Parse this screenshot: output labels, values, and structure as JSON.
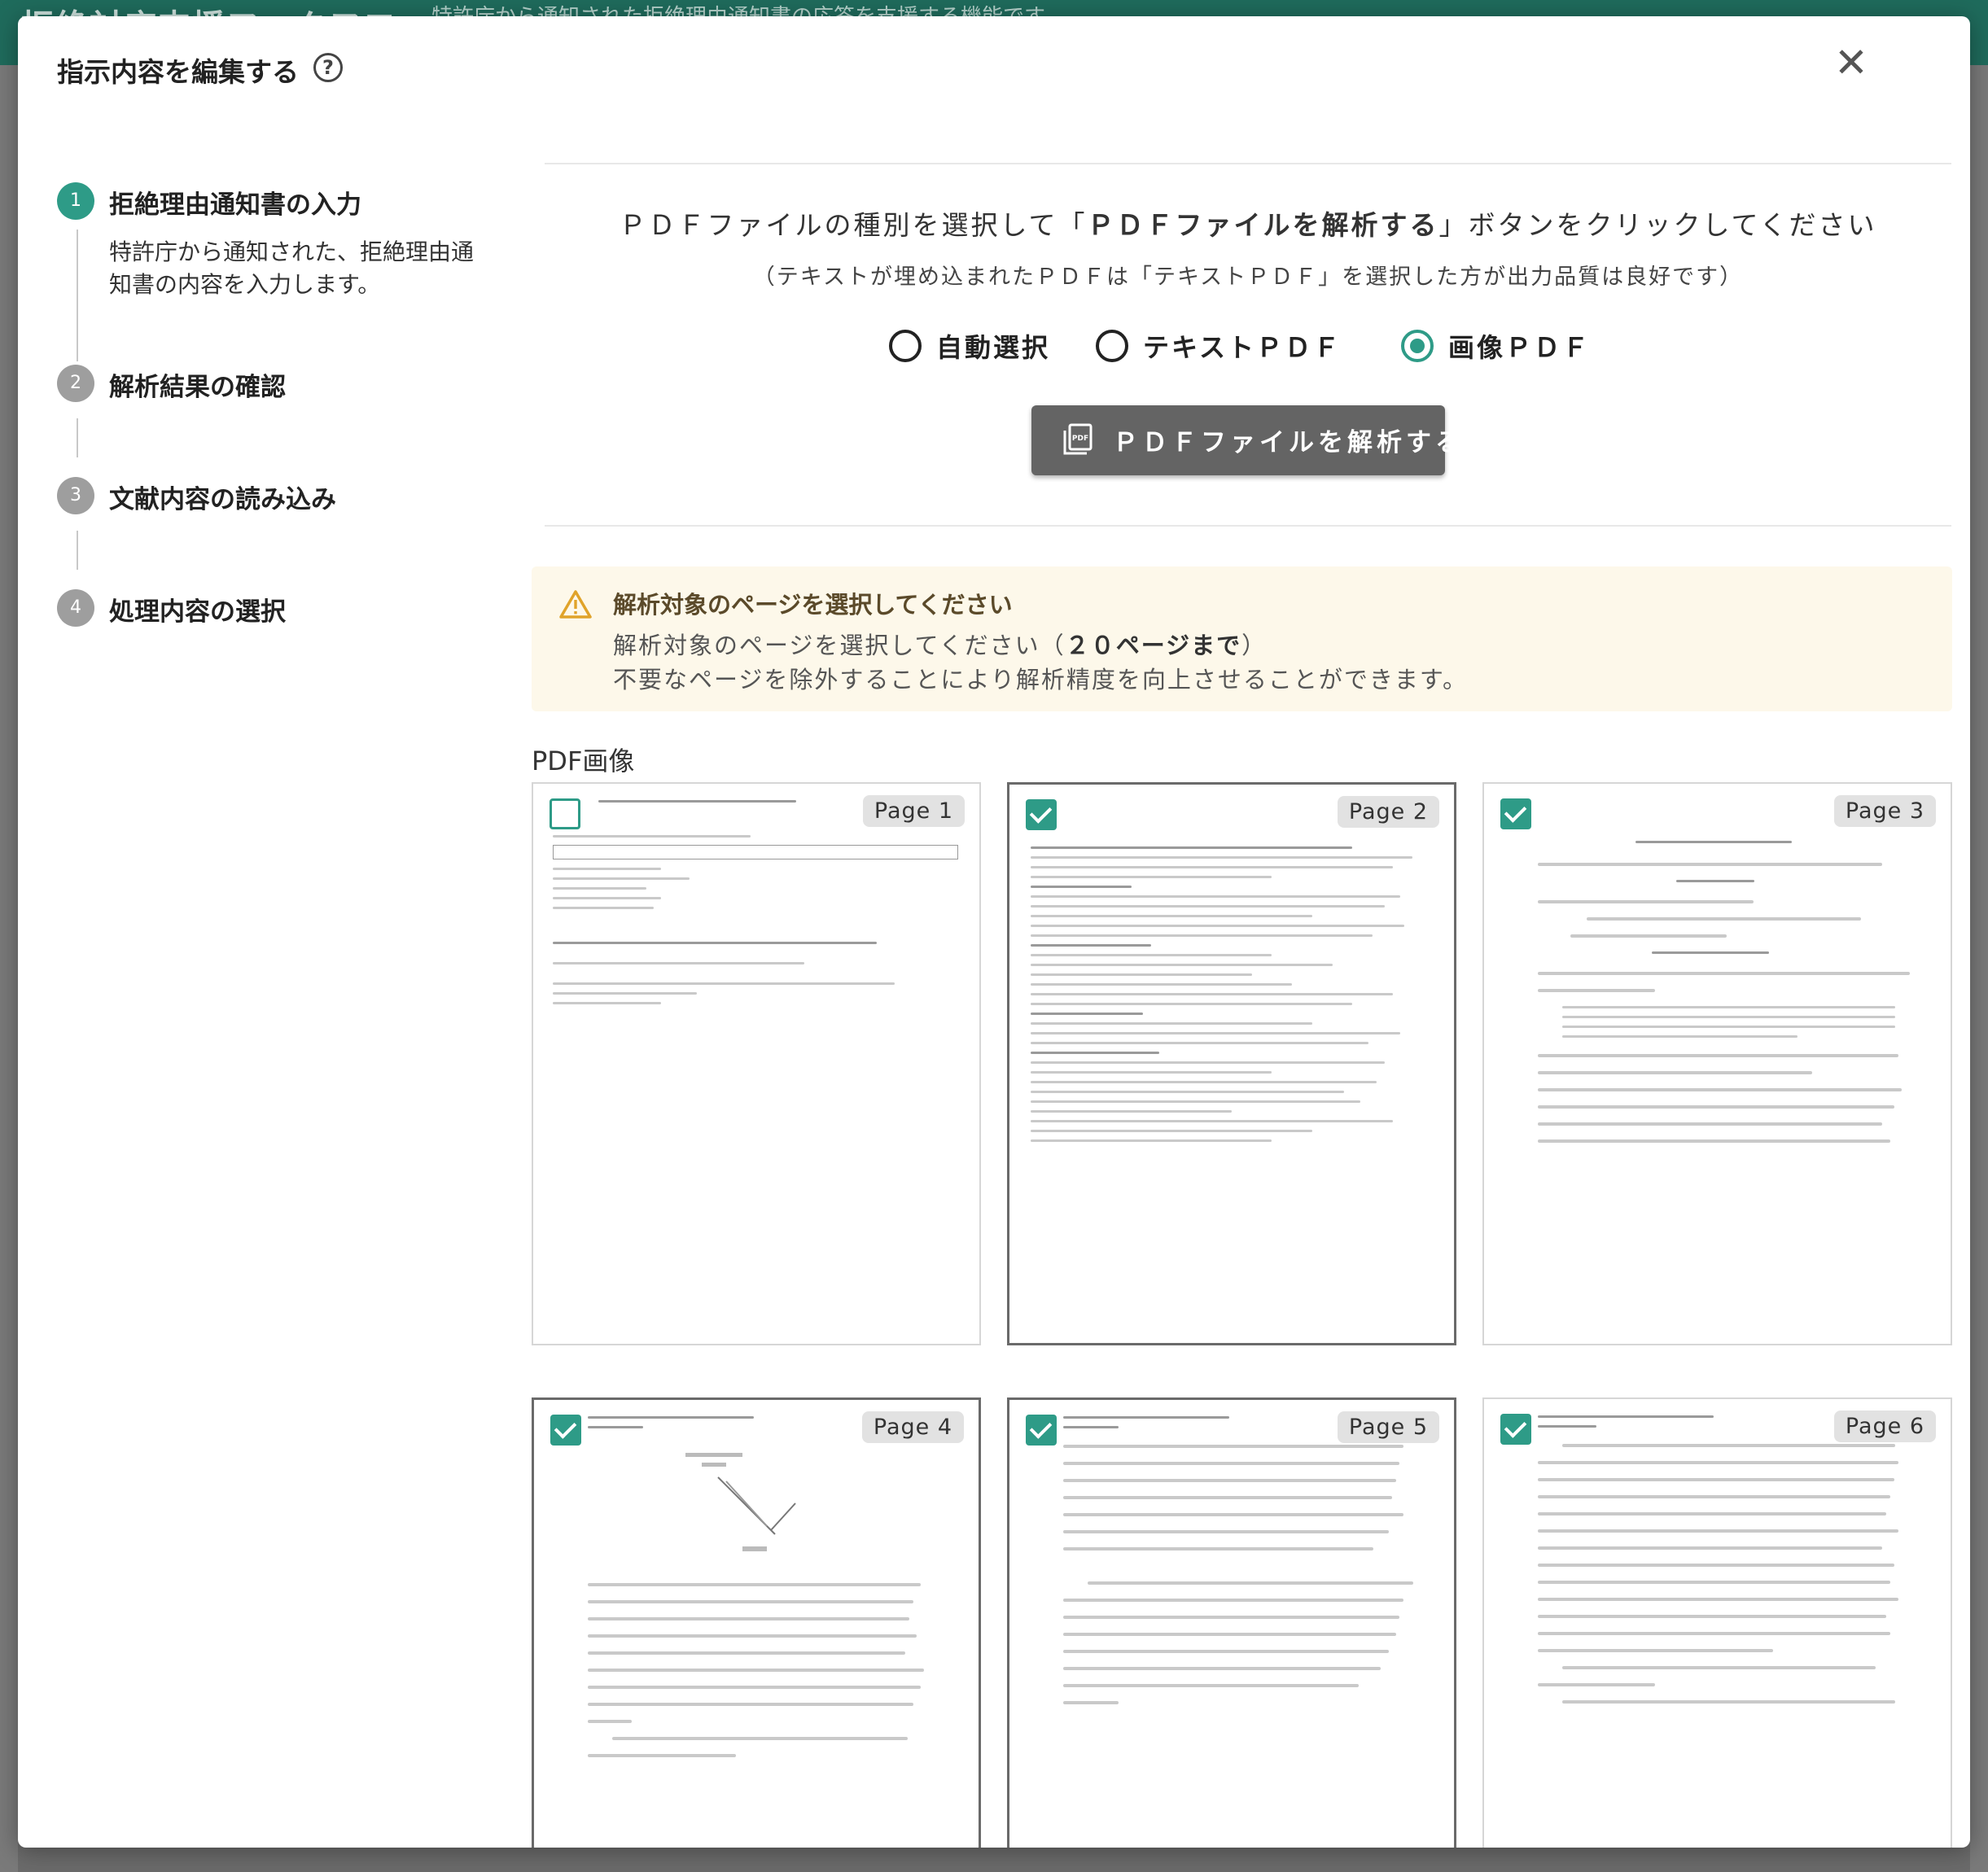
{
  "background": {
    "header_title": "拒絶対応支援ワークフロー",
    "header_subtitle": "特許庁から通知された拒絶理由通知書の応答を支援する機能です"
  },
  "modal": {
    "title": "指示内容を編集する",
    "help_icon": "question-circle-icon",
    "close_icon": "close-icon"
  },
  "steps": [
    {
      "number": "1",
      "label": "拒絶理由通知書の入力",
      "description": "特許庁から通知された、拒絶理由通知書の内容を入力します。",
      "active": true
    },
    {
      "number": "2",
      "label": "解析結果の確認",
      "active": false
    },
    {
      "number": "3",
      "label": "文献内容の読み込み",
      "active": false
    },
    {
      "number": "4",
      "label": "処理内容の選択",
      "active": false
    }
  ],
  "instruction": {
    "prefix": "ＰＤＦファイルの種別を選択して「",
    "emphasis": "ＰＤＦファイルを解析する",
    "suffix": "」ボタンをクリックしてください",
    "note": "（テキストが埋め込まれたＰＤＦは「テキストＰＤＦ」を選択した方が出力品質は良好です）"
  },
  "pdf_type": {
    "options": [
      "自動選択",
      "テキストＰＤＦ",
      "画像ＰＤＦ"
    ],
    "selected": "画像ＰＤＦ"
  },
  "analyze_button": {
    "label": "ＰＤＦファイルを解析する",
    "icon": "pdf-file-icon"
  },
  "alert": {
    "icon": "warning-icon",
    "title": "解析対象のページを選択してください",
    "line1_prefix": "解析対象のページを選択してください（",
    "line1_emphasis": "２０ページまで",
    "line1_suffix": "）",
    "line2": "不要なページを除外することにより解析精度を向上させることができます。"
  },
  "pdf_images": {
    "label": "PDF画像",
    "pages": [
      {
        "label": "Page 1",
        "checked": false
      },
      {
        "label": "Page 2",
        "checked": true
      },
      {
        "label": "Page 3",
        "checked": true
      },
      {
        "label": "Page 4",
        "checked": true
      },
      {
        "label": "Page 5",
        "checked": true
      },
      {
        "label": "Page 6",
        "checked": true
      }
    ]
  },
  "colors": {
    "accent": "#2e9b87",
    "button": "#646464",
    "alert_bg": "#fdf8ea"
  }
}
